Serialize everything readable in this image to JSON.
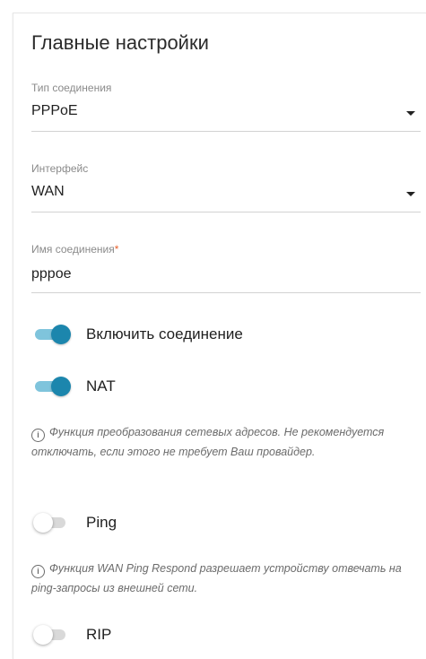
{
  "section": {
    "title": "Главные настройки"
  },
  "connection_type": {
    "label": "Тип соединения",
    "value": "PPPoE"
  },
  "interface": {
    "label": "Интерфейс",
    "value": "WAN"
  },
  "connection_name": {
    "label": "Имя соединения",
    "required_mark": "*",
    "value": "pppoe"
  },
  "toggles": {
    "enable_connection": {
      "label": "Включить соединение",
      "on": true
    },
    "nat": {
      "label": "NAT",
      "on": true
    },
    "ping": {
      "label": "Ping",
      "on": false
    },
    "rip": {
      "label": "RIP",
      "on": false
    }
  },
  "hints": {
    "info_glyph": "i",
    "nat": "Функция преобразования сетевых адресов. Не рекомендуется отключать, если этого не требует Ваш провайдер.",
    "ping": "Функция WAN Ping Respond разрешает устройству отвечать на ping-запросы из внешней сети."
  },
  "colors": {
    "accent": "#1c86ad",
    "accent_track": "#7fc4dc",
    "required": "#e8612c"
  }
}
